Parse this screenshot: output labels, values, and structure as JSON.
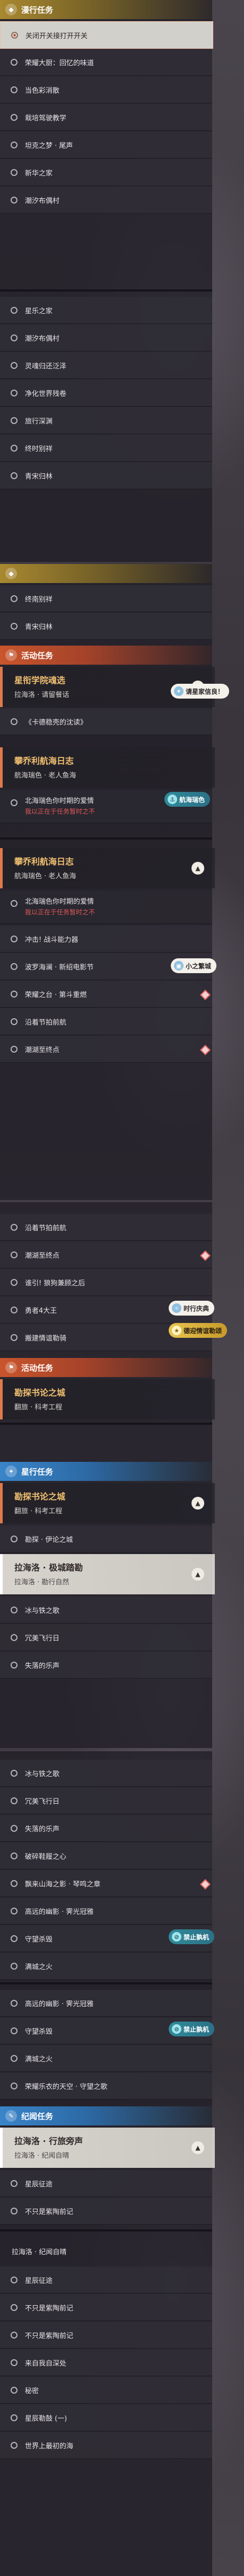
{
  "categories": {
    "mission": {
      "label": "漫行任务",
      "icon": "diamond-icon"
    },
    "activity": {
      "label": "活动任务",
      "icon": "flag-icon"
    },
    "star": {
      "label": "星行任务",
      "icon": "star-icon"
    },
    "records": {
      "label": "纪闻任务",
      "icon": "book-icon"
    }
  },
  "panel1": {
    "highlight": "关闭开关接打开开关",
    "rows_a": [
      "荣耀大厨：回忆的味道",
      "当色彩消散",
      "栽培驾驶教学",
      "坦克之梦 · 尾声",
      "新华之家",
      "潮汐布偶村"
    ],
    "rows_b": [
      "星乐之家",
      "潮汐布偶村",
      "灵魂归还泛泽",
      "净化世界残卷",
      "旅行深渊",
      "终时别祥",
      "青宋归林"
    ]
  },
  "panel2": {
    "rows_top": [
      "终南别祥",
      "青宋归林"
    ],
    "task1": {
      "title": "星衔学院魂选",
      "sub": "拉海洛 · 请留餐话"
    },
    "task1_tag": "请星家信良！",
    "task1_row": "《卡德稳壳的沈读》",
    "task2": {
      "title": "攀乔利航海日志",
      "sub": "航海瑞色 · 老人鱼海"
    },
    "task2_tag": "航海瑞色",
    "fail1": {
      "text": "北海瑞色你时期的爱情",
      "warn": "我以正在于任务暂时之不"
    },
    "task3": {
      "title": "攀乔利航海日志",
      "sub": "航海瑞色 · 老人鱼海"
    },
    "fail2": {
      "text": "北海瑞色你时期的爱情",
      "warn": "我以正在于任务暂时之不"
    },
    "rows_mid": [
      "冲击! 战斗能力器",
      "波罗海澜 · 新绍电影节",
      "荣耀之台 · 第斗重燃",
      "沿着节拍前航",
      "潮湖至终点"
    ],
    "mid_tag": "小之繁城"
  },
  "panel3": {
    "rows_top": [
      "沿着节拍前航",
      "潮湖至终点",
      "谁引! 狼狗兼顾之后",
      "勇者4大王",
      "搬建情谊勒骑"
    ],
    "tag_a": "时行庆典",
    "tag_b": "德迎情谊勒颂",
    "task1": {
      "title": "勘探书论之城",
      "sub": "翻旅 · 科考工程"
    },
    "task2": {
      "title": "勘探书论之城",
      "sub": "翻旅 · 科考工程"
    },
    "row_after": "勘探 · 伊论之城",
    "task3": {
      "title": "拉海洛 · 极城踏勘",
      "sub": "拉海洛 · 勘行自然"
    },
    "rows_bottom": [
      "冰与铁之歌",
      "冗美飞行日",
      "失落的乐声"
    ]
  },
  "panel4": {
    "rows_top": [
      "冰与铁之歌",
      "冗美飞行日",
      "失落的乐声",
      "破碎鞋履之心",
      "飘来山海之影 · 琴鸣之章",
      "高远的幽影 · 霁光冠雅",
      "守望杀毁",
      "满城之火"
    ],
    "tag_a": "禁止孰机",
    "rows_mid": [
      "高远的幽影 · 霁光冠雅",
      "守望杀毁",
      "满城之火",
      "荣耀乐衣的天空 · 守望之歌"
    ],
    "tag_b": "禁止孰机",
    "task1": {
      "title": "拉海洛 · 行旅旁声",
      "sub": "拉海洛 · 纪闻自晴"
    },
    "rows_task1": [
      "星辰征途",
      "不只是紫陶前记"
    ],
    "label_after": "拉海洛 · 纪闻自晴",
    "rows_bottom": [
      "星辰征途",
      "不只是紫陶前记",
      "不只是紫陶前记",
      "来自我自深处",
      "秘密",
      "星辰勒鼓 (一)",
      "世界上最初的海"
    ]
  }
}
